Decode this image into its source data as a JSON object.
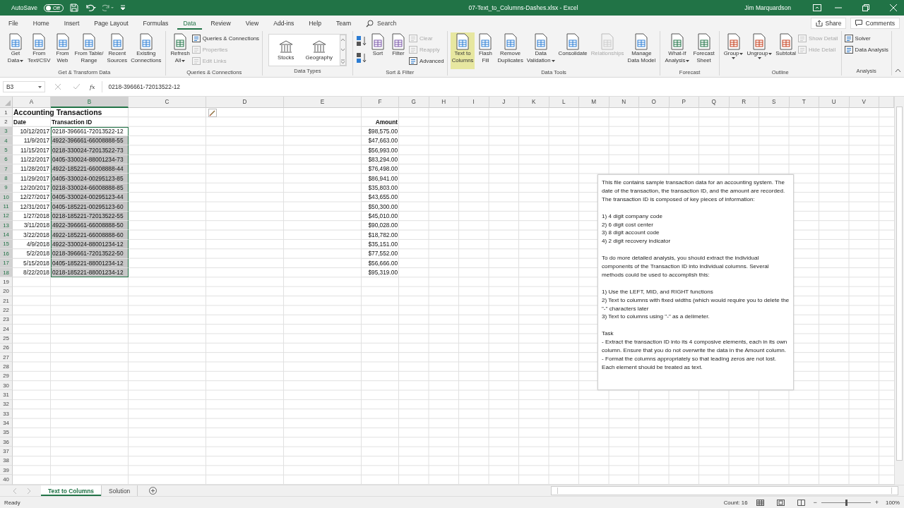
{
  "window": {
    "autosave_label": "AutoSave",
    "autosave": {
      "on": false,
      "label": "Off"
    },
    "title": "07-Text_to_Columns-Dashes.xlsx  -  Excel",
    "user": "Jim Marquardson"
  },
  "menu": {
    "tabs": [
      {
        "label": "File",
        "selected": false
      },
      {
        "label": "Home",
        "selected": false
      },
      {
        "label": "Insert",
        "selected": false
      },
      {
        "label": "Page Layout",
        "selected": false
      },
      {
        "label": "Formulas",
        "selected": false
      },
      {
        "label": "Data",
        "selected": true
      },
      {
        "label": "Review",
        "selected": false
      },
      {
        "label": "View",
        "selected": false
      },
      {
        "label": "Add-ins",
        "selected": false
      },
      {
        "label": "Help",
        "selected": false
      },
      {
        "label": "Team",
        "selected": false
      }
    ],
    "search": "Search",
    "share": "Share",
    "comments": "Comments"
  },
  "ribbon": {
    "groups": [
      {
        "label": "Get & Transform Data",
        "buttons": [
          {
            "kind": "large",
            "lines": [
              "Get",
              "Data"
            ],
            "dropdown": true,
            "disabled": false,
            "hovered": false
          },
          {
            "kind": "large",
            "lines": [
              "From",
              "Text/CSV"
            ],
            "dropdown": false,
            "disabled": false,
            "hovered": false
          },
          {
            "kind": "large",
            "lines": [
              "From",
              "Web"
            ],
            "dropdown": false,
            "disabled": false,
            "hovered": false
          },
          {
            "kind": "large",
            "lines": [
              "From Table/",
              "Range"
            ],
            "dropdown": false,
            "disabled": false,
            "hovered": false
          },
          {
            "kind": "large",
            "lines": [
              "Recent",
              "Sources"
            ],
            "dropdown": false,
            "disabled": false,
            "hovered": false
          },
          {
            "kind": "large",
            "lines": [
              "Existing",
              "Connections"
            ],
            "dropdown": false,
            "disabled": false,
            "hovered": false
          }
        ]
      },
      {
        "label": "Queries & Connections",
        "buttons": [
          {
            "kind": "large",
            "lines": [
              "Refresh",
              "All"
            ],
            "dropdown": true,
            "disabled": false,
            "hovered": false
          },
          {
            "kind": "stack",
            "items": [
              {
                "label": "Queries & Connections",
                "disabled": false
              },
              {
                "label": "Properties",
                "disabled": true
              },
              {
                "label": "Edit Links",
                "disabled": true
              }
            ]
          }
        ]
      },
      {
        "label": "Data Types",
        "buttons": [
          {
            "kind": "gallery",
            "items": [
              {
                "label": "Stocks"
              },
              {
                "label": "Geography"
              }
            ]
          }
        ]
      },
      {
        "label": "Sort & Filter",
        "buttons": [
          {
            "kind": "sort"
          },
          {
            "kind": "large",
            "lines": [
              "Sort"
            ],
            "dropdown": false,
            "disabled": false,
            "hovered": false
          },
          {
            "kind": "large",
            "lines": [
              "Filter"
            ],
            "dropdown": false,
            "disabled": false,
            "hovered": false
          },
          {
            "kind": "stack",
            "items": [
              {
                "label": "Clear",
                "disabled": true
              },
              {
                "label": "Reapply",
                "disabled": true
              },
              {
                "label": "Advanced",
                "disabled": false
              }
            ]
          }
        ]
      },
      {
        "label": "Data Tools",
        "buttons": [
          {
            "kind": "large",
            "lines": [
              "Text to",
              "Columns"
            ],
            "dropdown": false,
            "disabled": false,
            "hovered": true
          },
          {
            "kind": "large",
            "lines": [
              "Flash",
              "Fill"
            ],
            "dropdown": false,
            "disabled": false,
            "hovered": false
          },
          {
            "kind": "large",
            "lines": [
              "Remove",
              "Duplicates"
            ],
            "dropdown": false,
            "disabled": false,
            "hovered": false
          },
          {
            "kind": "large",
            "lines": [
              "Data",
              "Validation"
            ],
            "dropdown": true,
            "disabled": false,
            "hovered": false
          },
          {
            "kind": "large",
            "lines": [
              "Consolidate"
            ],
            "dropdown": false,
            "disabled": false,
            "hovered": false
          },
          {
            "kind": "large",
            "lines": [
              "Relationships"
            ],
            "dropdown": false,
            "disabled": true,
            "hovered": false
          },
          {
            "kind": "large",
            "lines": [
              "Manage",
              "Data Model"
            ],
            "dropdown": false,
            "disabled": false,
            "hovered": false
          }
        ]
      },
      {
        "label": "Forecast",
        "buttons": [
          {
            "kind": "large",
            "lines": [
              "What-If",
              "Analysis"
            ],
            "dropdown": true,
            "disabled": false,
            "hovered": false
          },
          {
            "kind": "large",
            "lines": [
              "Forecast",
              "Sheet"
            ],
            "dropdown": false,
            "disabled": false,
            "hovered": false
          }
        ]
      },
      {
        "label": "Outline",
        "buttons": [
          {
            "kind": "large",
            "lines": [
              "Group"
            ],
            "dropdown": true,
            "disabled": false,
            "hovered": false
          },
          {
            "kind": "large",
            "lines": [
              "Ungroup"
            ],
            "dropdown": true,
            "disabled": false,
            "hovered": false
          },
          {
            "kind": "large",
            "lines": [
              "Subtotal"
            ],
            "dropdown": false,
            "disabled": false,
            "hovered": false
          },
          {
            "kind": "stack",
            "items": [
              {
                "label": "Show Detail",
                "disabled": true
              },
              {
                "label": "Hide Detail",
                "disabled": true
              }
            ]
          }
        ]
      },
      {
        "label": "Analysis",
        "buttons": [
          {
            "kind": "stack",
            "items": [
              {
                "label": "Solver",
                "disabled": false
              },
              {
                "label": "Data Analysis",
                "disabled": false
              }
            ]
          }
        ]
      }
    ]
  },
  "formula_bar": {
    "name_box": "B3",
    "function_label": "fx",
    "formula": "0218-396661-72013522-12"
  },
  "sheet": {
    "columns": [
      {
        "label": "A",
        "selected": false
      },
      {
        "label": "B",
        "selected": true
      },
      {
        "label": "C",
        "selected": false
      },
      {
        "label": "D",
        "selected": false
      },
      {
        "label": "E",
        "selected": false
      },
      {
        "label": "F",
        "selected": false
      },
      {
        "label": "G",
        "selected": false
      },
      {
        "label": "H",
        "selected": false
      },
      {
        "label": "I",
        "selected": false
      },
      {
        "label": "J",
        "selected": false
      },
      {
        "label": "K",
        "selected": false
      },
      {
        "label": "L",
        "selected": false
      },
      {
        "label": "M",
        "selected": false
      },
      {
        "label": "N",
        "selected": false
      },
      {
        "label": "O",
        "selected": false
      },
      {
        "label": "P",
        "selected": false
      },
      {
        "label": "Q",
        "selected": false
      },
      {
        "label": "R",
        "selected": false
      },
      {
        "label": "S",
        "selected": false
      },
      {
        "label": "T",
        "selected": false
      },
      {
        "label": "U",
        "selected": false
      },
      {
        "label": "V",
        "selected": false
      }
    ],
    "row_headers": [
      {
        "label": "1",
        "selected": false
      },
      {
        "label": "2",
        "selected": false
      },
      {
        "label": "3",
        "selected": true
      },
      {
        "label": "4",
        "selected": true
      },
      {
        "label": "5",
        "selected": true
      },
      {
        "label": "6",
        "selected": true
      },
      {
        "label": "7",
        "selected": true
      },
      {
        "label": "8",
        "selected": true
      },
      {
        "label": "9",
        "selected": true
      },
      {
        "label": "10",
        "selected": true
      },
      {
        "label": "11",
        "selected": true
      },
      {
        "label": "12",
        "selected": true
      },
      {
        "label": "13",
        "selected": true
      },
      {
        "label": "14",
        "selected": true
      },
      {
        "label": "15",
        "selected": true
      },
      {
        "label": "16",
        "selected": true
      },
      {
        "label": "17",
        "selected": true
      },
      {
        "label": "18",
        "selected": true
      },
      {
        "label": "19",
        "selected": false
      },
      {
        "label": "20",
        "selected": false
      },
      {
        "label": "21",
        "selected": false
      },
      {
        "label": "22",
        "selected": false
      },
      {
        "label": "23",
        "selected": false
      },
      {
        "label": "24",
        "selected": false
      },
      {
        "label": "25",
        "selected": false
      },
      {
        "label": "26",
        "selected": false
      },
      {
        "label": "27",
        "selected": false
      },
      {
        "label": "28",
        "selected": false
      },
      {
        "label": "29",
        "selected": false
      },
      {
        "label": "30",
        "selected": false
      },
      {
        "label": "31",
        "selected": false
      },
      {
        "label": "32",
        "selected": false
      },
      {
        "label": "33",
        "selected": false
      },
      {
        "label": "34",
        "selected": false
      },
      {
        "label": "35",
        "selected": false
      },
      {
        "label": "36",
        "selected": false
      },
      {
        "label": "37",
        "selected": false
      },
      {
        "label": "38",
        "selected": false
      },
      {
        "label": "39",
        "selected": false
      },
      {
        "label": "40",
        "selected": false
      }
    ],
    "title": "Accounting Transactions",
    "headers": {
      "date": "Date",
      "id": "Transaction ID",
      "amount": "Amount"
    },
    "records": [
      {
        "date": "10/12/2017",
        "id": "0218-396661-72013522-12",
        "amount": "$98,575.00",
        "selected": true,
        "active": true
      },
      {
        "date": "11/9/2017",
        "id": "4922-396661-66008888-55",
        "amount": "$47,663.00",
        "selected": true,
        "active": false
      },
      {
        "date": "11/15/2017",
        "id": "0218-330024-72013522-73",
        "amount": "$56,993.00",
        "selected": true,
        "active": false
      },
      {
        "date": "11/22/2017",
        "id": "0405-330024-88001234-73",
        "amount": "$83,294.00",
        "selected": true,
        "active": false
      },
      {
        "date": "11/28/2017",
        "id": "4922-185221-66008888-44",
        "amount": "$76,498.00",
        "selected": true,
        "active": false
      },
      {
        "date": "11/29/2017",
        "id": "0405-330024-00295123-85",
        "amount": "$86,941.00",
        "selected": true,
        "active": false
      },
      {
        "date": "12/20/2017",
        "id": "0218-330024-66008888-85",
        "amount": "$35,803.00",
        "selected": true,
        "active": false
      },
      {
        "date": "12/27/2017",
        "id": "0405-330024-00295123-44",
        "amount": "$43,655.00",
        "selected": true,
        "active": false
      },
      {
        "date": "12/31/2017",
        "id": "0405-185221-00295123-60",
        "amount": "$50,300.00",
        "selected": true,
        "active": false
      },
      {
        "date": "1/27/2018",
        "id": "0218-185221-72013522-55",
        "amount": "$45,010.00",
        "selected": true,
        "active": false
      },
      {
        "date": "3/11/2018",
        "id": "4922-396661-66008888-50",
        "amount": "$90,028.00",
        "selected": true,
        "active": false
      },
      {
        "date": "3/22/2018",
        "id": "4922-185221-66008888-60",
        "amount": "$18,782.00",
        "selected": true,
        "active": false
      },
      {
        "date": "4/9/2018",
        "id": "4922-330024-88001234-12",
        "amount": "$35,151.00",
        "selected": true,
        "active": false
      },
      {
        "date": "5/2/2018",
        "id": "0218-396661-72013522-50",
        "amount": "$77,552.00",
        "selected": true,
        "active": false
      },
      {
        "date": "5/15/2018",
        "id": "0405-185221-88001234-12",
        "amount": "$56,666.00",
        "selected": true,
        "active": false
      },
      {
        "date": "8/22/2018",
        "id": "0218-185221-88001234-12",
        "amount": "$95,319.00",
        "selected": true,
        "active": false
      }
    ],
    "textbox": {
      "blocks": [
        {
          "lines": [
            "This file contains sample transaction data for an accounting system. The date of the transaction, the transaction ID, and the amount are recorded. The transaction ID is composed of key pieces of information:"
          ]
        },
        {
          "lines": [
            "1) 4 digit company code",
            "2) 6 digit cost center",
            "3) 8 digit account code",
            "4) 2 digit recovery indicator"
          ]
        },
        {
          "lines": [
            "To do more detailed analysis, you should extract the individual components of the Transaction ID into individual columns. Several methods could be used to accomplish this:"
          ]
        },
        {
          "lines": [
            "1) Use the LEFT, MID, and RIGHT functions",
            "2) Text to columns with fixed widths (which would require you to delete the \"-\" characters later",
            "3) Text to columns using \"-\" as a delimeter."
          ]
        },
        {
          "lines": [
            "Task",
            "- Extract the transaction ID into its 4 composive elements, each in its own column. Ensure that you do not overwrite the data in the Amount column.",
            "- Format the columns appropriately so that leading zeros are not lost. Each element should be treated as text."
          ]
        }
      ]
    }
  },
  "sheet_tabs": [
    {
      "label": "Text to Columns",
      "selected": true
    },
    {
      "label": "Solution",
      "selected": false
    }
  ],
  "status_bar": {
    "mode": "Ready",
    "count": "Count: 16",
    "zoom": {
      "minus": "−",
      "plus": "+",
      "level": 0.5,
      "label": "100%"
    }
  }
}
